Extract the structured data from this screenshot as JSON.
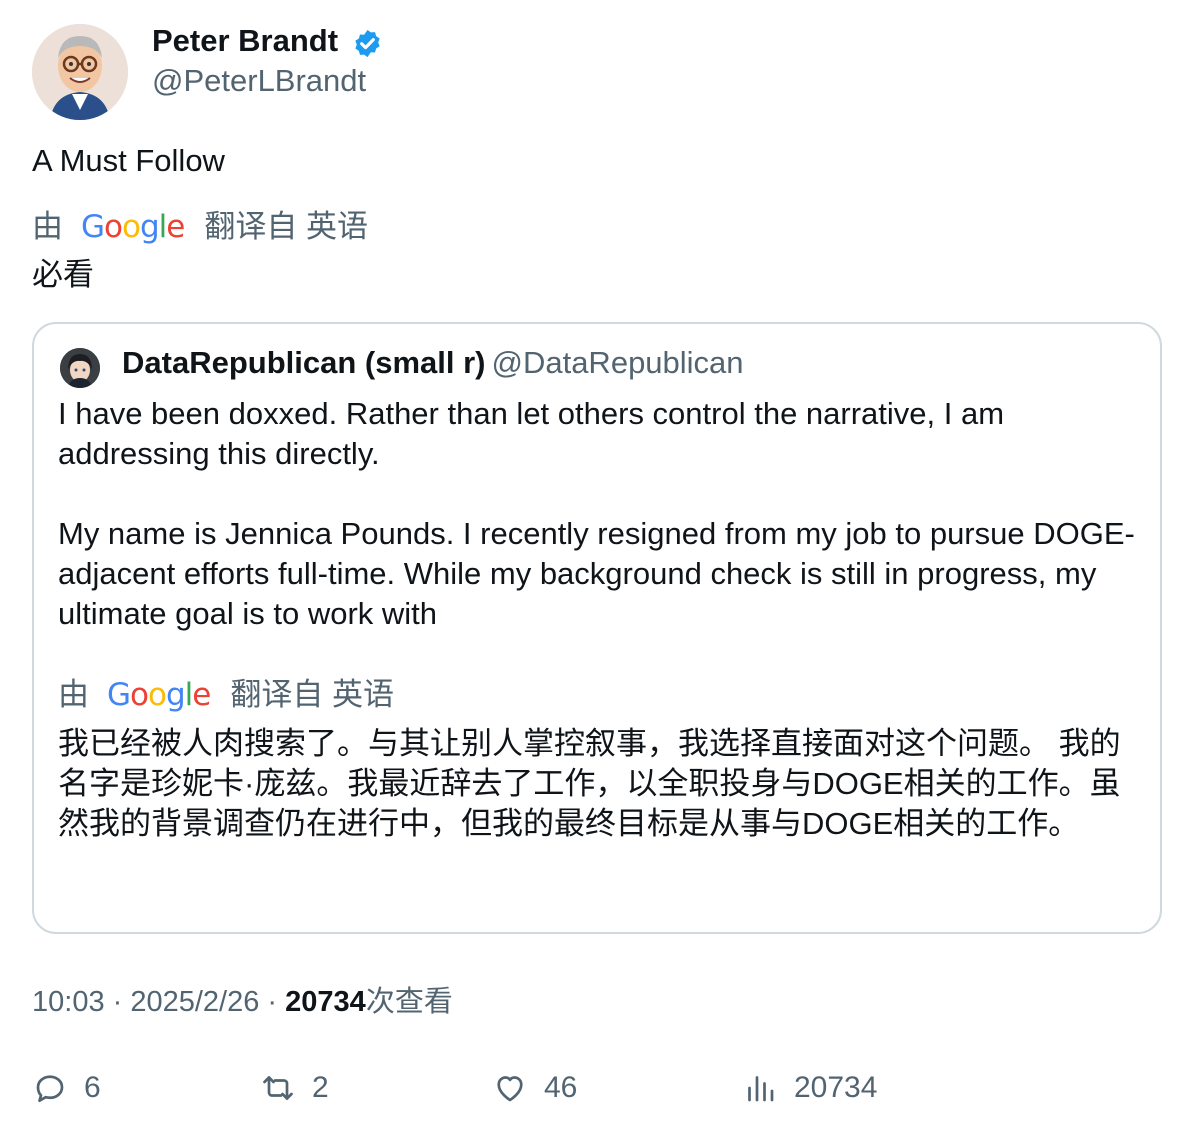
{
  "author": {
    "name": "Peter Brandt",
    "handle": "@PeterLBrandt",
    "verified_color": "#1d9bf0"
  },
  "tweet": {
    "text": "A Must Follow",
    "translation": {
      "by": "由",
      "provider": [
        "G",
        "o",
        "o",
        "g",
        "l",
        "e"
      ],
      "from": "翻译自 英语",
      "text": "必看"
    }
  },
  "quote": {
    "name": "DataRepublican (small r)",
    "handle": "@DataRepublican",
    "paragraphs": [
      "I have been doxxed. Rather than let others control the narrative, I am addressing this directly.",
      "My name is Jennica Pounds. I recently resigned from my job to pursue DOGE-adjacent efforts full-time. While my background check is still in progress, my ultimate goal is to work with"
    ],
    "translation": {
      "by": "由",
      "from": "翻译自 英语",
      "text": "我已经被人肉搜索了。与其让别人掌控叙事，我选择直接面对这个问题。 我的名字是珍妮卡·庞兹。我最近辞去了工作，以全职投身与DOGE相关的工作。虽然我的背景调查仍在进行中，但我的最终目标是从事与DOGE相关的工作。"
    }
  },
  "meta": {
    "time": "10:03",
    "sep": " · ",
    "date": "2025/2/26",
    "views_count": "20734",
    "views_label": "次查看"
  },
  "actions": {
    "replies": "6",
    "retweets": "2",
    "likes": "46",
    "views": "20734"
  },
  "icons": {
    "verified": "verified-badge-icon",
    "reply": "reply-icon",
    "retweet": "retweet-icon",
    "like": "heart-icon",
    "views": "bar-chart-icon"
  },
  "colors": {
    "text": "#0f1419",
    "secondary": "#536471",
    "border": "#cfd9de",
    "google_blue": "#4285f4",
    "google_red": "#ea4335",
    "google_yellow": "#fbbc05",
    "google_green": "#34a853"
  }
}
